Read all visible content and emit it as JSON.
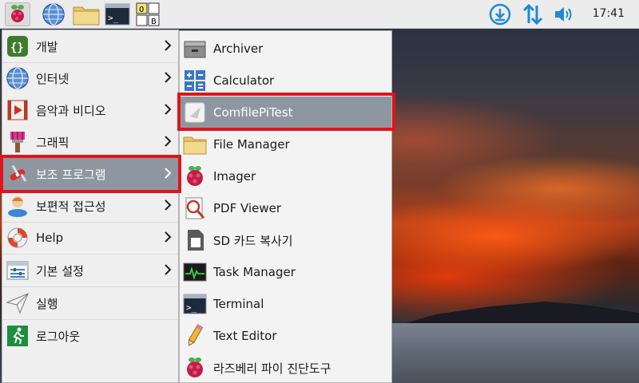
{
  "taskbar": {
    "clock": "17:41",
    "icons": [
      "raspberry-icon",
      "web-browser-icon",
      "file-manager-icon",
      "terminal-icon",
      "keyboard-layout-icon",
      "download-icon",
      "network-icon",
      "volume-icon"
    ],
    "keyboard_layout": {
      "a": "0",
      "b": "B"
    }
  },
  "main_menu": {
    "items": [
      {
        "label": "개발",
        "icon": "programming-icon",
        "has_submenu": true
      },
      {
        "label": "인터넷",
        "icon": "globe-icon",
        "has_submenu": true
      },
      {
        "label": "음악과 비디오",
        "icon": "media-icon",
        "has_submenu": true
      },
      {
        "label": "그래픽",
        "icon": "paintbrush-icon",
        "has_submenu": true
      },
      {
        "label": "보조 프로그램",
        "icon": "swiss-knife-icon",
        "has_submenu": true,
        "selected": true
      },
      {
        "label": "보편적 접근성",
        "icon": "accessibility-icon",
        "has_submenu": true
      },
      {
        "label": "Help",
        "icon": "lifebuoy-icon",
        "has_submenu": true
      },
      {
        "label": "기본 설정",
        "icon": "preferences-icon",
        "has_submenu": true
      },
      {
        "label": "실행",
        "icon": "paper-plane-icon",
        "has_submenu": false
      },
      {
        "label": "로그아웃",
        "icon": "exit-icon",
        "has_submenu": false
      }
    ]
  },
  "sub_menu": {
    "items": [
      {
        "label": "Archiver",
        "icon": "archive-icon"
      },
      {
        "label": "Calculator",
        "icon": "calculator-icon"
      },
      {
        "label": "ComfilePiTest",
        "icon": "application-icon",
        "selected": true
      },
      {
        "label": "File Manager",
        "icon": "folder-icon"
      },
      {
        "label": "Imager",
        "icon": "raspberry-icon"
      },
      {
        "label": "PDF Viewer",
        "icon": "pdf-viewer-icon"
      },
      {
        "label": "SD 카드 복사기",
        "icon": "sd-card-icon"
      },
      {
        "label": "Task Manager",
        "icon": "task-manager-icon"
      },
      {
        "label": "Terminal",
        "icon": "terminal-icon"
      },
      {
        "label": "Text Editor",
        "icon": "text-editor-icon"
      },
      {
        "label": "라즈베리 파이 진단도구",
        "icon": "raspberry-icon"
      }
    ]
  },
  "colors": {
    "highlight_border": "#e0141c",
    "selected_row": "#8e97a1",
    "menu_bg": "#efefef",
    "taskbar_bg": "#ececec",
    "tray_blue": "#1e8ad6"
  }
}
